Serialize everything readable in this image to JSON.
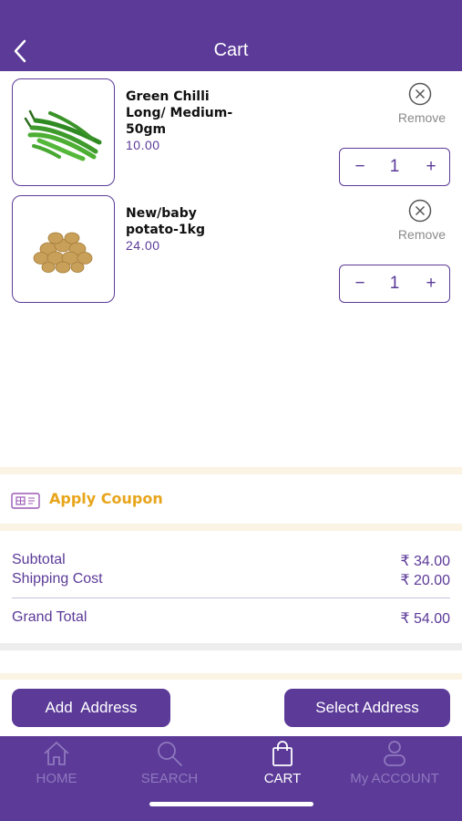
{
  "header": {
    "title": "Cart"
  },
  "cart": {
    "items": [
      {
        "name": "Green Chilli Long/ Medium-50gm",
        "price": "10.00",
        "quantity": "1",
        "remove_label": "Remove"
      },
      {
        "name": "New/baby potato-1kg",
        "price": "24.00",
        "quantity": "1",
        "remove_label": "Remove"
      }
    ],
    "stepper": {
      "minus": "−",
      "plus": "+"
    }
  },
  "coupon": {
    "label": "Apply Coupon"
  },
  "summary": {
    "subtotal_label": "Subtotal",
    "subtotal_value": "₹ 34.00",
    "shipping_label": "Shipping Cost",
    "shipping_value": "₹ 20.00",
    "grand_total_label": "Grand Total",
    "grand_total_value": "₹ 54.00"
  },
  "buttons": {
    "add_address": "Add  Address",
    "select_address": "Select Address"
  },
  "tabbar": {
    "tabs": [
      {
        "label": "HOME",
        "icon": "home-icon"
      },
      {
        "label": "SEARCH",
        "icon": "search-icon"
      },
      {
        "label": "CART",
        "icon": "cart-icon"
      },
      {
        "label": "My ACCOUNT",
        "icon": "account-icon"
      }
    ],
    "active": "CART"
  },
  "colors": {
    "primary": "#5b3a98",
    "accent": "#e8a51b",
    "muted": "#8f78be"
  }
}
